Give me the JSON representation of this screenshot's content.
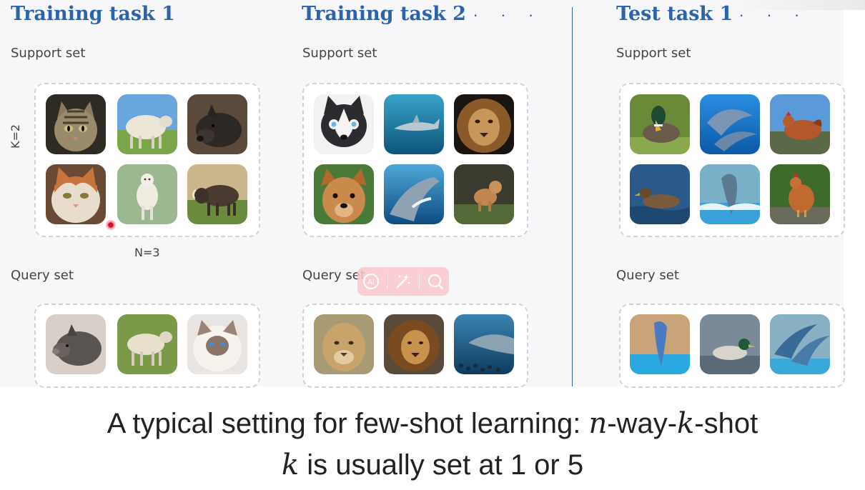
{
  "tasks": [
    {
      "title": "Training task 1",
      "support_label": "Support set",
      "query_label": "Query set",
      "k_label": "K=2",
      "n_label": "N=3",
      "support": [
        "cat-tabby",
        "sheep",
        "boar",
        "cat-calico",
        "lamb",
        "warthog"
      ],
      "query": [
        "pig",
        "sheep",
        "cat-himalayan"
      ]
    },
    {
      "title": "Training task 2",
      "support_label": "Support set",
      "query_label": "Query set",
      "support": [
        "husky",
        "shark",
        "lion",
        "dog",
        "shark",
        "lion-cub"
      ],
      "query": [
        "lioness",
        "lion",
        "shark"
      ]
    },
    {
      "title": "Test task 1",
      "support_label": "Support set",
      "query_label": "Query set",
      "support": [
        "mallard",
        "dolphins",
        "hen",
        "duck-swimming",
        "dolphin-jump",
        "hen"
      ],
      "query": [
        "dolphin-show",
        "mallard",
        "dolphins-leap"
      ]
    }
  ],
  "continuation_dots": "· · ·",
  "toolbar": {
    "ai_label": "AI",
    "icons": [
      "ai-icon",
      "magic-wand-icon",
      "search-icon"
    ]
  },
  "caption": {
    "line1_prefix": "A typical setting for few-shot learning: ",
    "line1_n": "n",
    "line1_mid": "-way-",
    "line1_k": "k",
    "line1_suffix": "-shot",
    "line2_k": "k",
    "line2_rest": " is usually set at 1 or 5"
  },
  "colors": {
    "title_blue": "#2b64ad",
    "divider_blue": "#3a5fa8",
    "toolbar_pink": "#f8c8cd",
    "marker_red": "#d4102a"
  }
}
